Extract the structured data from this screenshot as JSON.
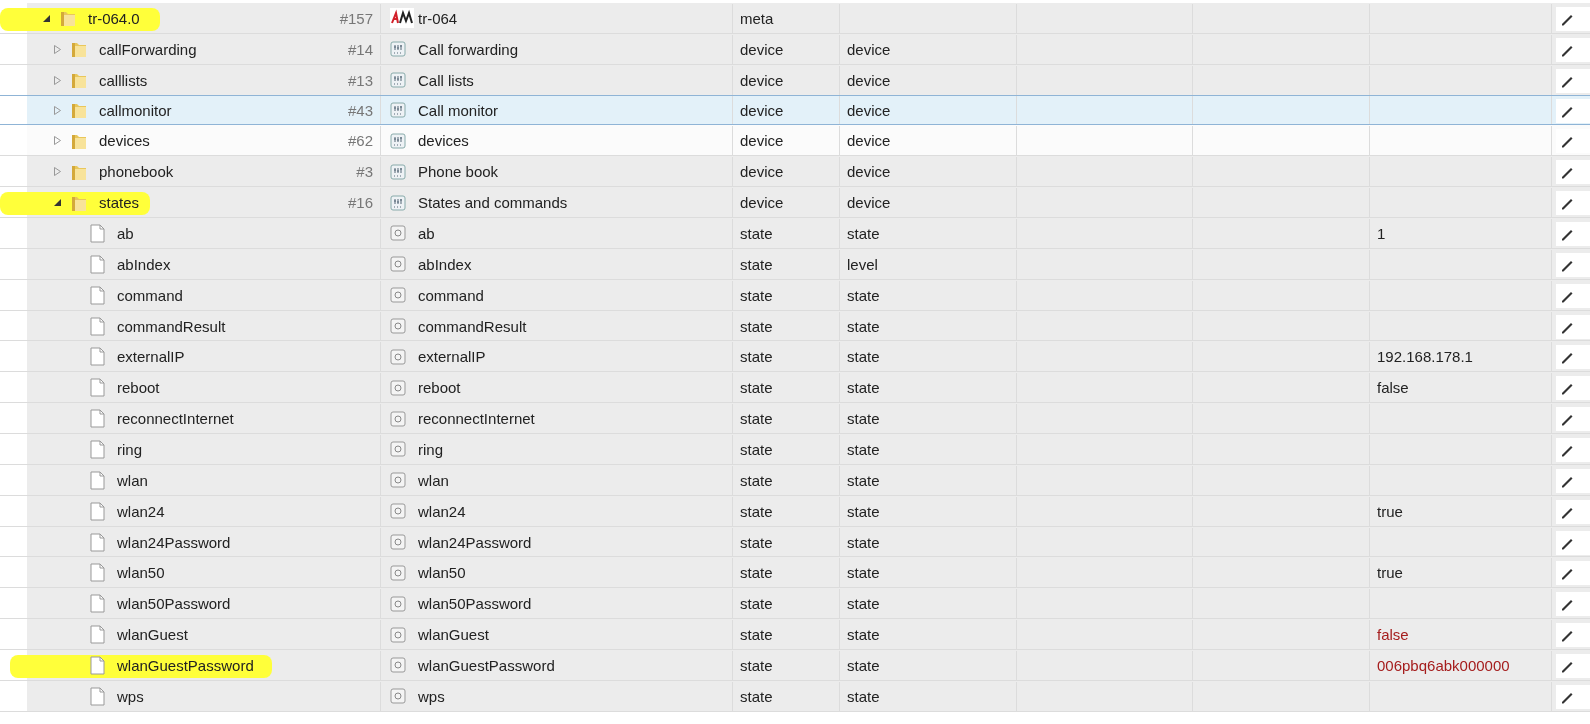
{
  "tree": [
    {
      "name": "tr-064.0",
      "kind": "instance",
      "expanded": true,
      "marked": true,
      "selected": false,
      "hovered": false,
      "count": "#157",
      "title": "tr-064",
      "type": "meta",
      "children": [
        {
          "name": "callForwarding",
          "kind": "device",
          "expanded": false,
          "selected": false,
          "hovered": false,
          "count": "#14",
          "title": "Call forwarding",
          "type": "device",
          "role": "device"
        },
        {
          "name": "calllists",
          "kind": "device",
          "expanded": false,
          "selected": false,
          "hovered": false,
          "count": "#13",
          "title": "Call lists",
          "type": "device",
          "role": "device"
        },
        {
          "name": "callmonitor",
          "kind": "device",
          "expanded": false,
          "selected": true,
          "hovered": false,
          "count": "#43",
          "title": "Call monitor",
          "type": "device",
          "role": "device"
        },
        {
          "name": "devices",
          "kind": "device",
          "expanded": false,
          "selected": false,
          "hovered": true,
          "count": "#62",
          "title": "devices",
          "type": "device",
          "role": "device"
        },
        {
          "name": "phonebook",
          "kind": "device",
          "expanded": false,
          "selected": false,
          "hovered": false,
          "count": "#3",
          "title": "Phone book",
          "type": "device",
          "role": "device"
        },
        {
          "name": "states",
          "kind": "device",
          "expanded": true,
          "marked": true,
          "selected": false,
          "hovered": false,
          "count": "#16",
          "title": "States and commands",
          "type": "device",
          "role": "device",
          "children": [
            {
              "name": "ab",
              "kind": "state",
              "selected": false,
              "hovered": false,
              "title": "ab",
              "type": "state",
              "role": "state",
              "value": "1",
              "ack": true
            },
            {
              "name": "abIndex",
              "kind": "state",
              "selected": false,
              "hovered": false,
              "title": "abIndex",
              "type": "state",
              "role": "level"
            },
            {
              "name": "command",
              "kind": "state",
              "selected": false,
              "hovered": false,
              "title": "command",
              "type": "state",
              "role": "state"
            },
            {
              "name": "commandResult",
              "kind": "state",
              "selected": false,
              "hovered": false,
              "title": "commandResult",
              "type": "state",
              "role": "state"
            },
            {
              "name": "externalIP",
              "kind": "state",
              "selected": false,
              "hovered": false,
              "title": "externalIP",
              "type": "state",
              "role": "state",
              "value": "192.168.178.1",
              "ack": true
            },
            {
              "name": "reboot",
              "kind": "state",
              "selected": false,
              "hovered": false,
              "title": "reboot",
              "type": "state",
              "role": "state",
              "value": "false",
              "ack": true
            },
            {
              "name": "reconnectInternet",
              "kind": "state",
              "selected": false,
              "hovered": false,
              "title": "reconnectInternet",
              "type": "state",
              "role": "state"
            },
            {
              "name": "ring",
              "kind": "state",
              "selected": false,
              "hovered": false,
              "title": "ring",
              "type": "state",
              "role": "state"
            },
            {
              "name": "wlan",
              "kind": "state",
              "selected": false,
              "hovered": false,
              "title": "wlan",
              "type": "state",
              "role": "state"
            },
            {
              "name": "wlan24",
              "kind": "state",
              "selected": false,
              "hovered": false,
              "title": "wlan24",
              "type": "state",
              "role": "state",
              "value": "true",
              "ack": true
            },
            {
              "name": "wlan24Password",
              "kind": "state",
              "selected": false,
              "hovered": false,
              "title": "wlan24Password",
              "type": "state",
              "role": "state"
            },
            {
              "name": "wlan50",
              "kind": "state",
              "selected": false,
              "hovered": false,
              "title": "wlan50",
              "type": "state",
              "role": "state",
              "value": "true",
              "ack": true
            },
            {
              "name": "wlan50Password",
              "kind": "state",
              "selected": false,
              "hovered": false,
              "title": "wlan50Password",
              "type": "state",
              "role": "state"
            },
            {
              "name": "wlanGuest",
              "kind": "state",
              "selected": false,
              "hovered": false,
              "title": "wlanGuest",
              "type": "state",
              "role": "state",
              "value": "false",
              "ack": false
            },
            {
              "name": "wlanGuestPassword",
              "kind": "state",
              "marked": true,
              "selected": false,
              "hovered": false,
              "title": "wlanGuestPassword",
              "type": "state",
              "role": "state",
              "value": "006pbq6abk000000",
              "ack": false
            },
            {
              "name": "wps",
              "kind": "state",
              "selected": false,
              "hovered": false,
              "title": "wps",
              "type": "state",
              "role": "state"
            }
          ]
        }
      ]
    }
  ]
}
